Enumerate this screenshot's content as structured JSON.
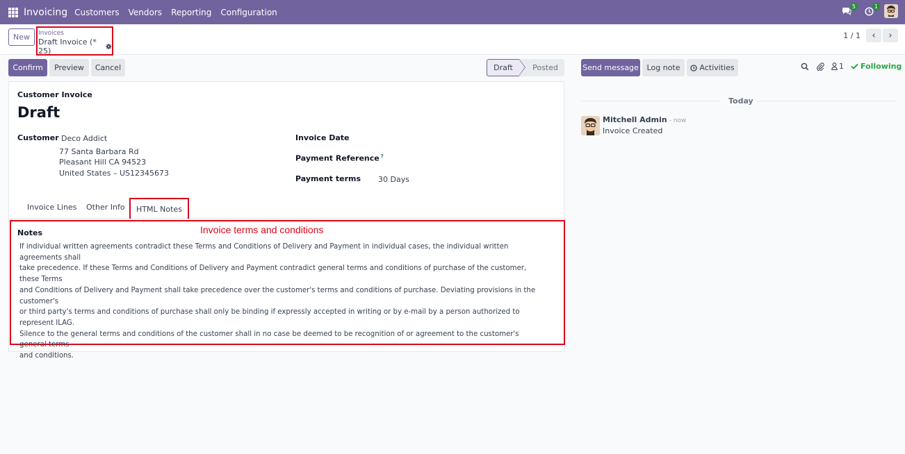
{
  "topbar": {
    "app_name": "Invoicing",
    "menu": [
      "Customers",
      "Vendors",
      "Reporting",
      "Configuration"
    ],
    "messages_count": "5",
    "activities_count": "1"
  },
  "control": {
    "new_label": "New",
    "breadcrumb_parent": "Invoices",
    "breadcrumb_current": "Draft Invoice (* 25)",
    "pager": "1 / 1"
  },
  "actions": {
    "confirm": "Confirm",
    "preview": "Preview",
    "cancel": "Cancel"
  },
  "status": {
    "current": "Draft",
    "next": "Posted"
  },
  "form": {
    "doc_type": "Customer Invoice",
    "doc_name": "Draft",
    "customer_label": "Customer",
    "customer_name": "Deco Addict",
    "address_line1": "77 Santa Barbara Rd",
    "address_line2": "Pleasant Hill CA 94523",
    "address_line3": "United States – US12345673",
    "invoice_date_label": "Invoice Date",
    "payment_ref_label": "Payment Reference",
    "payment_ref_help": "?",
    "payment_terms_label": "Payment terms",
    "payment_terms_value": "30 Days"
  },
  "tabs": [
    "Invoice Lines",
    "Other Info",
    "HTML Notes"
  ],
  "notes": {
    "label": "Notes",
    "annotation": "Invoice terms and conditions",
    "lines": [
      "If individual written agreements contradict these Terms and Conditions of Delivery and Payment in individual cases, the individual written agreements shall",
      "take precedence. If these Terms and Conditions of Delivery and Payment contradict general terms and conditions of purchase of the customer, these Terms",
      "and Conditions of Delivery and Payment shall take precedence over the customer's terms and conditions of purchase. Deviating provisions in the customer's",
      "or third party's terms and conditions of purchase shall only be binding if expressly accepted in writing or by e-mail by a person authorized to represent ILAG.",
      "Silence to the general terms and conditions of the customer shall in no case be deemed to be recognition of or agreement to the customer's general terms",
      "and conditions."
    ]
  },
  "chatter": {
    "send_message": "Send message",
    "log_note": "Log note",
    "activities": "Activities",
    "followers_count": "1",
    "following": "Following",
    "today": "Today",
    "author": "Mitchell Admin",
    "time": "- now",
    "body": "Invoice Created"
  },
  "colors": {
    "brand": "#71639e",
    "annotation_red": "#d9061a",
    "following_green": "#28a745"
  }
}
